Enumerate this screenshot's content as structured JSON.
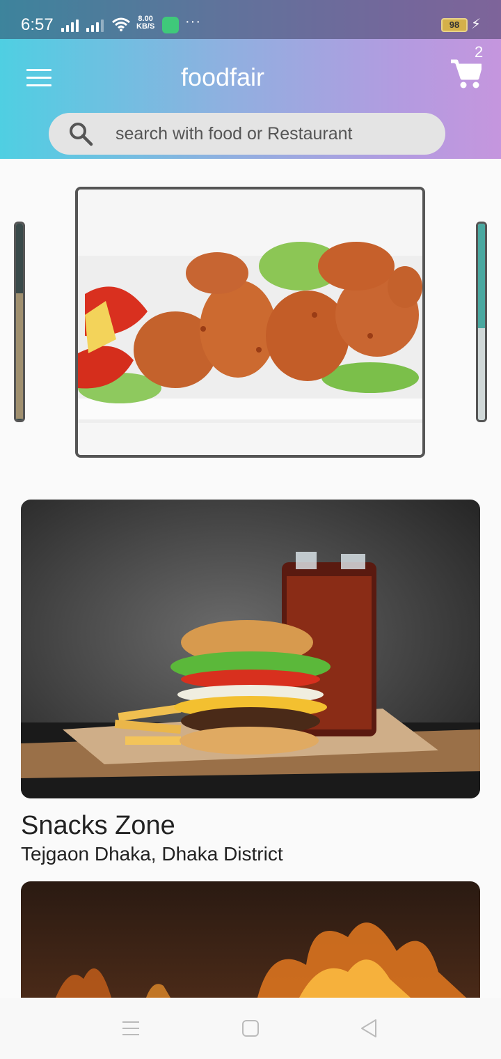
{
  "status_bar": {
    "time": "6:57",
    "net_speed_value": "8.00",
    "net_speed_unit": "KB/S",
    "dots": "···",
    "battery": "98"
  },
  "header": {
    "title": "foodfair",
    "cart_count": "2",
    "search_placeholder": "search with food or Restaurant"
  },
  "carousel": {
    "active_image": "fried-chicken-drumsticks"
  },
  "restaurants": [
    {
      "name": "Snacks Zone",
      "location": "Tejgaon Dhaka, Dhaka District",
      "image": "burger-fries-cola"
    },
    {
      "name": "",
      "location": "",
      "image": "flames"
    }
  ],
  "colors": {
    "gradient_start": "#4fcfe2",
    "gradient_end": "#c596de",
    "background": "#fafafa"
  }
}
